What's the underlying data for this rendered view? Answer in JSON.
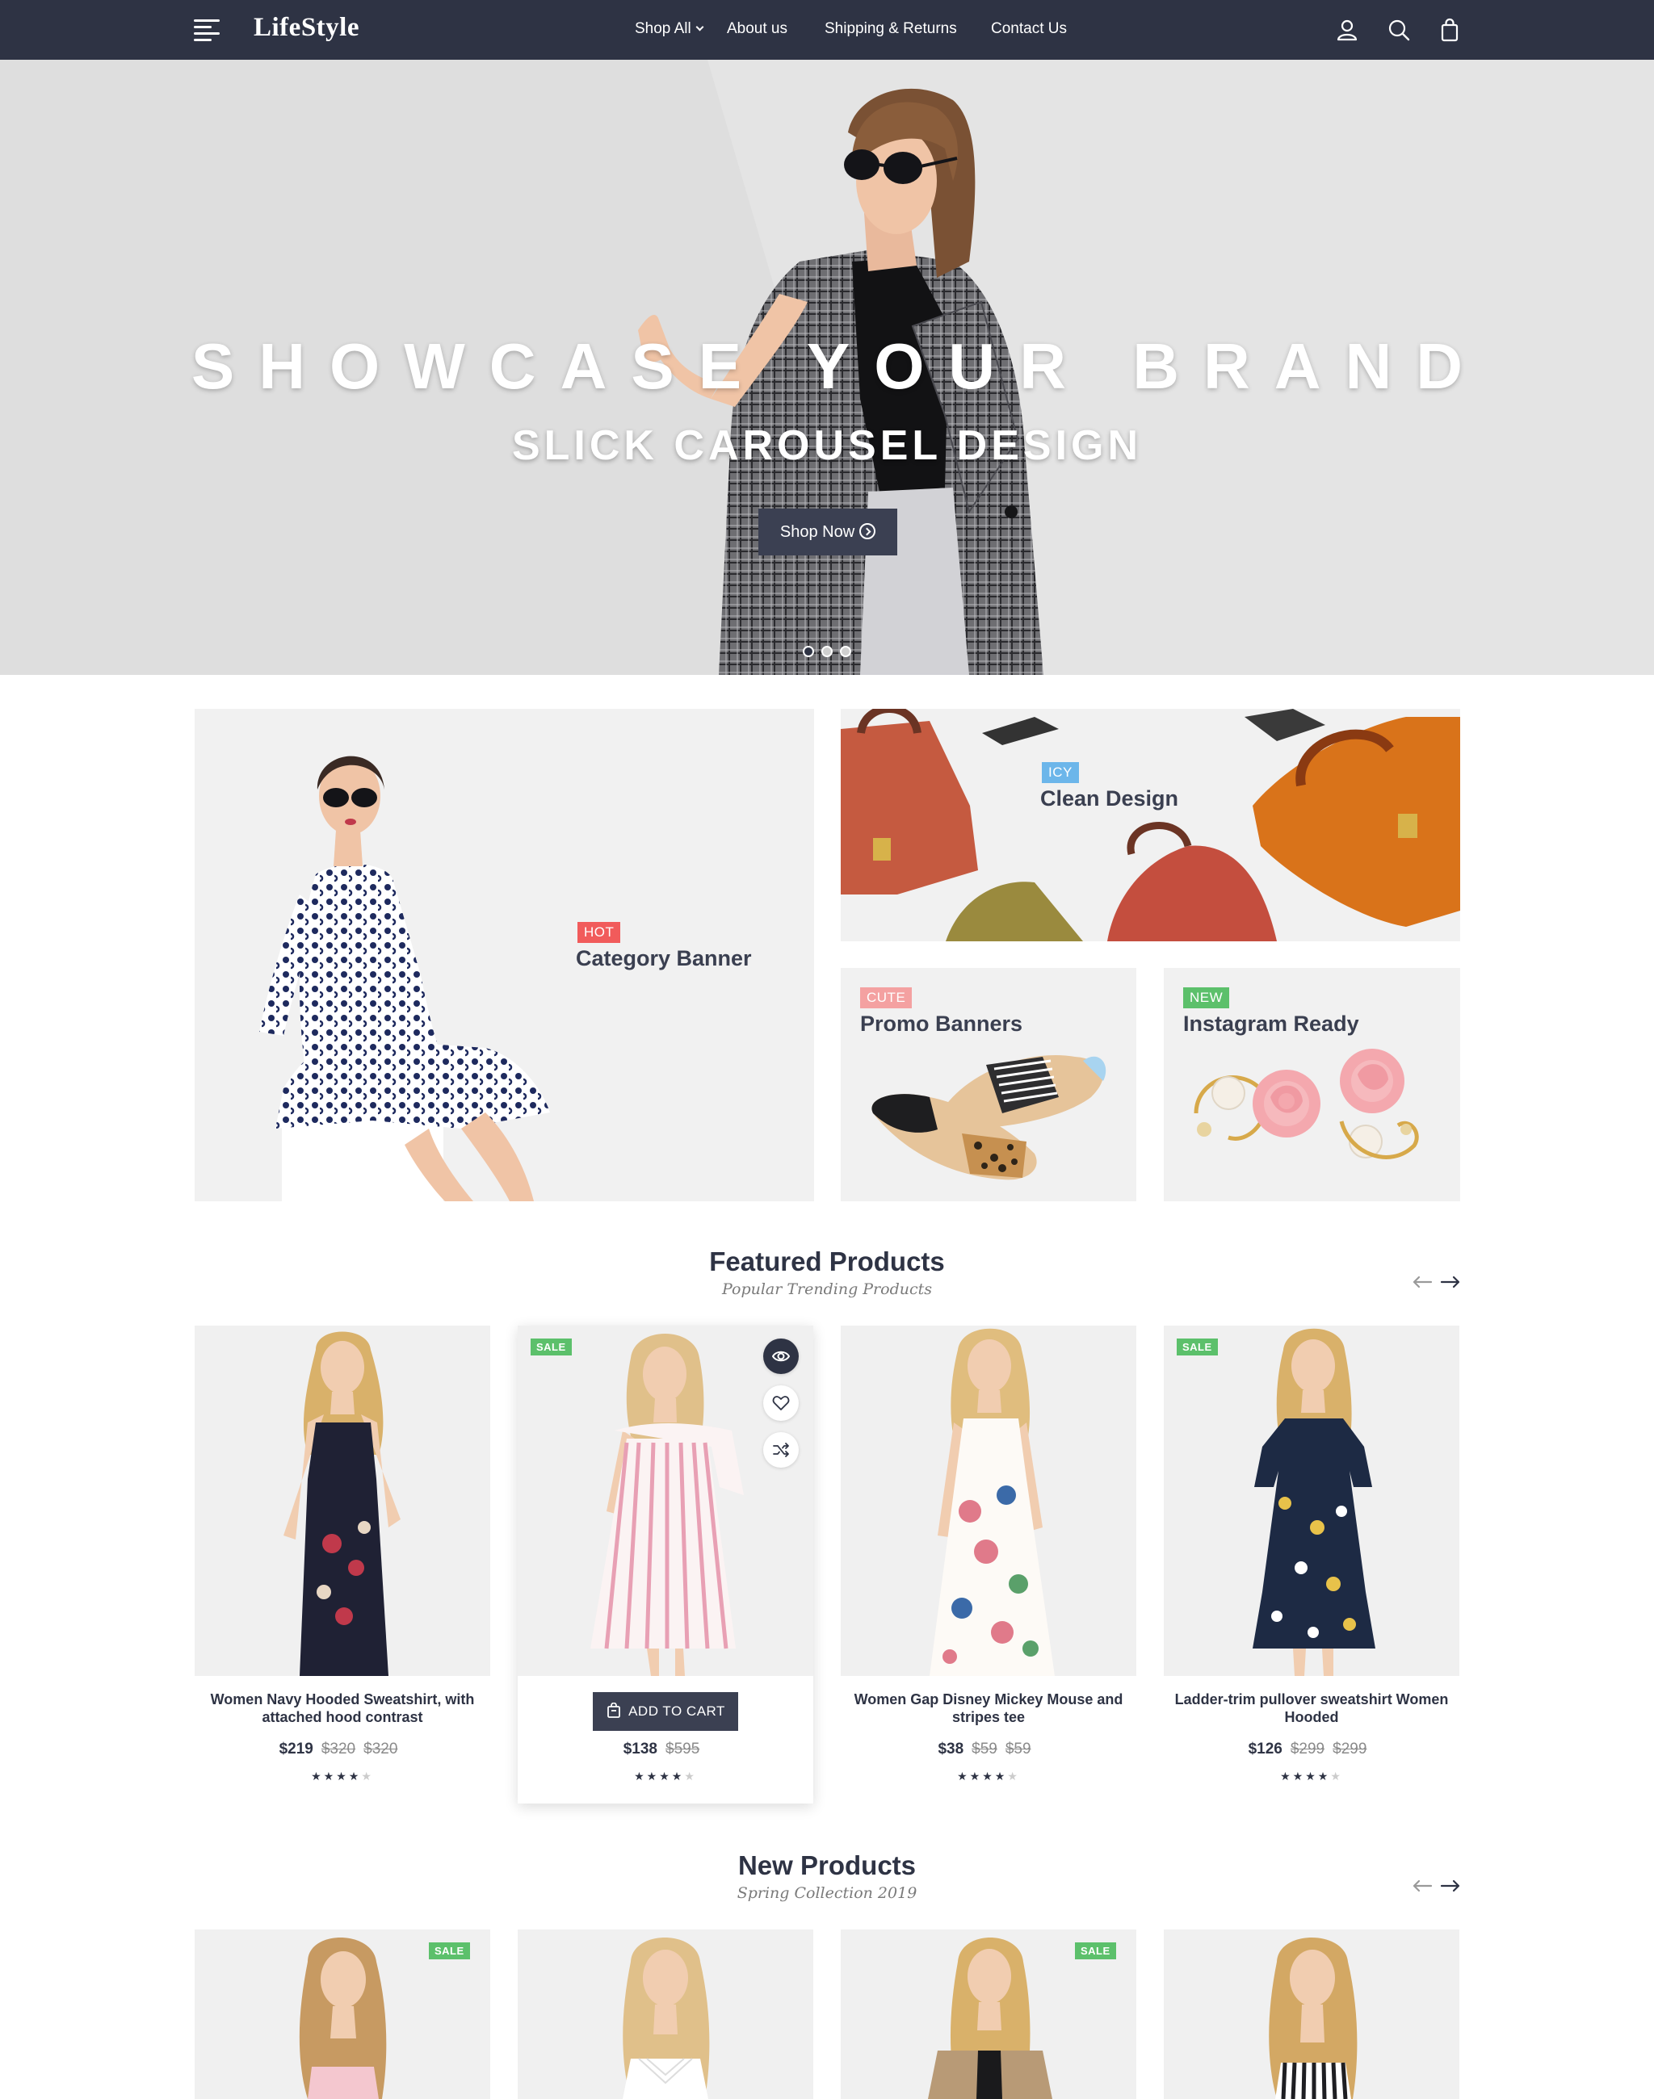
{
  "brand": {
    "name": "LifeStyle"
  },
  "nav": {
    "items": [
      {
        "label": "Shop All",
        "dropdown": true
      },
      {
        "label": "About us"
      },
      {
        "label": "Shipping & Returns"
      },
      {
        "label": "Contact Us"
      }
    ],
    "icons": [
      "user-icon",
      "search-icon",
      "shopping-bag-icon"
    ]
  },
  "hero": {
    "title": "SHOWCASE YOUR BRAND",
    "subtitle": "SLICK CAROUSEL DESIGN",
    "button_label": "Shop Now",
    "slide_count": 3,
    "active_slide": 1
  },
  "banners": [
    {
      "badge": "HOT",
      "badge_color": "#f15b5b",
      "title": "Category Banner"
    },
    {
      "badge": "ICY",
      "badge_color": "#6cb6ea",
      "title": "Clean Design"
    },
    {
      "badge": "CUTE",
      "badge_color": "#f4a1a1",
      "title": "Promo Banners"
    },
    {
      "badge": "NEW",
      "badge_color": "#5cc06b",
      "title": "Instagram Ready"
    }
  ],
  "featured": {
    "title": "Featured Products",
    "subtitle": "Popular Trending Products",
    "products": [
      {
        "name": "Women Navy Hooded Sweatshirt, with attached hood contrast",
        "price": "$219",
        "old_prices": [
          "$320",
          "$320"
        ],
        "rating": 4,
        "sale": false
      },
      {
        "name": "",
        "price": "$138",
        "old_prices": [
          "$595"
        ],
        "rating": 4,
        "sale": true,
        "add_to_cart_label": "ADD TO CART"
      },
      {
        "name": "Women Gap Disney Mickey Mouse and stripes tee",
        "price": "$38",
        "old_prices": [
          "$59",
          "$59"
        ],
        "rating": 4,
        "sale": false
      },
      {
        "name": "Ladder-trim pullover sweatshirt Women Hooded",
        "price": "$126",
        "old_prices": [
          "$299",
          "$299"
        ],
        "rating": 4,
        "sale": true
      }
    ]
  },
  "new_products": {
    "title": "New Products",
    "subtitle": "Spring Collection 2019",
    "products": [
      {
        "sale": true
      },
      {
        "sale": false
      },
      {
        "sale": true
      },
      {
        "sale": false
      }
    ]
  },
  "labels": {
    "sale": "SALE"
  },
  "colors": {
    "nav_bg": "#2e3344",
    "button_bg": "#3b4052",
    "sale_green": "#5cc06b",
    "hot_red": "#f15b5b",
    "icy_blue": "#6cb6ea",
    "cute_pink": "#f4a1a1",
    "card_bg": "#f0f0f0"
  }
}
